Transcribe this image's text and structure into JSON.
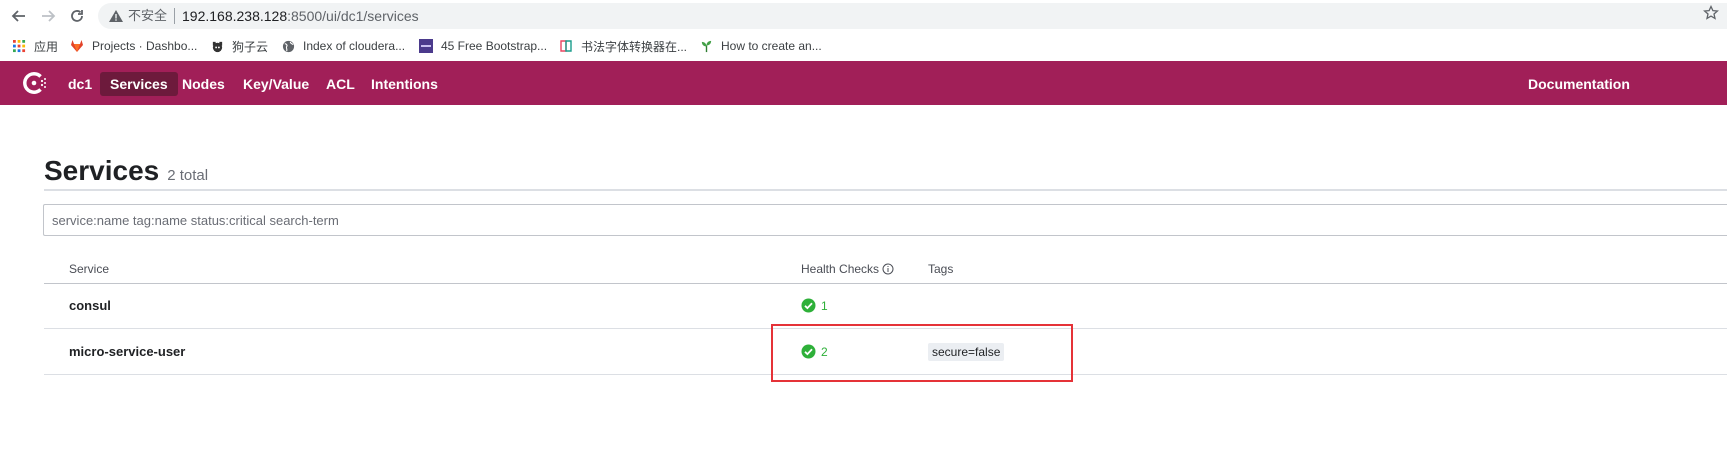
{
  "browser": {
    "insecure_label": "不安全",
    "url_host": "192.168.238.128",
    "url_rest": ":8500/ui/dc1/services",
    "back_icon": "arrow-left-icon",
    "forward_icon": "arrow-right-icon",
    "reload_icon": "reload-icon",
    "bookmark_star_icon": "star-icon"
  },
  "bookmarks": [
    {
      "label": "应用",
      "icon": "apps-grid-icon"
    },
    {
      "label": "Projects · Dashbo...",
      "icon": "gitlab-icon"
    },
    {
      "label": "狗子云",
      "icon": "dog-icon"
    },
    {
      "label": "Index of cloudera...",
      "icon": "globe-icon"
    },
    {
      "label": "45 Free Bootstrap...",
      "icon": "colorlib-icon"
    },
    {
      "label": "书法字体转换器在...",
      "icon": "calligraphy-icon"
    },
    {
      "label": "How to create an...",
      "icon": "sprout-icon"
    }
  ],
  "topnav": {
    "datacenter": "dc1",
    "items": [
      "Services",
      "Nodes",
      "Key/Value",
      "ACL",
      "Intentions"
    ],
    "active": "Services",
    "right_link": "Documentation"
  },
  "page": {
    "title": "Services",
    "count": "2 total",
    "search_placeholder": "service:name tag:name status:critical search-term"
  },
  "table": {
    "headers": {
      "service": "Service",
      "health": "Health Checks",
      "tags": "Tags"
    },
    "rows": [
      {
        "service": "consul",
        "health_passing": "1",
        "tags": []
      },
      {
        "service": "micro-service-user",
        "health_passing": "2",
        "tags": [
          "secure=false"
        ]
      }
    ]
  },
  "colors": {
    "brand": "#a11f58",
    "brand_active": "#6d1a3c",
    "passing": "#2eb039",
    "annotation": "#e53238"
  }
}
